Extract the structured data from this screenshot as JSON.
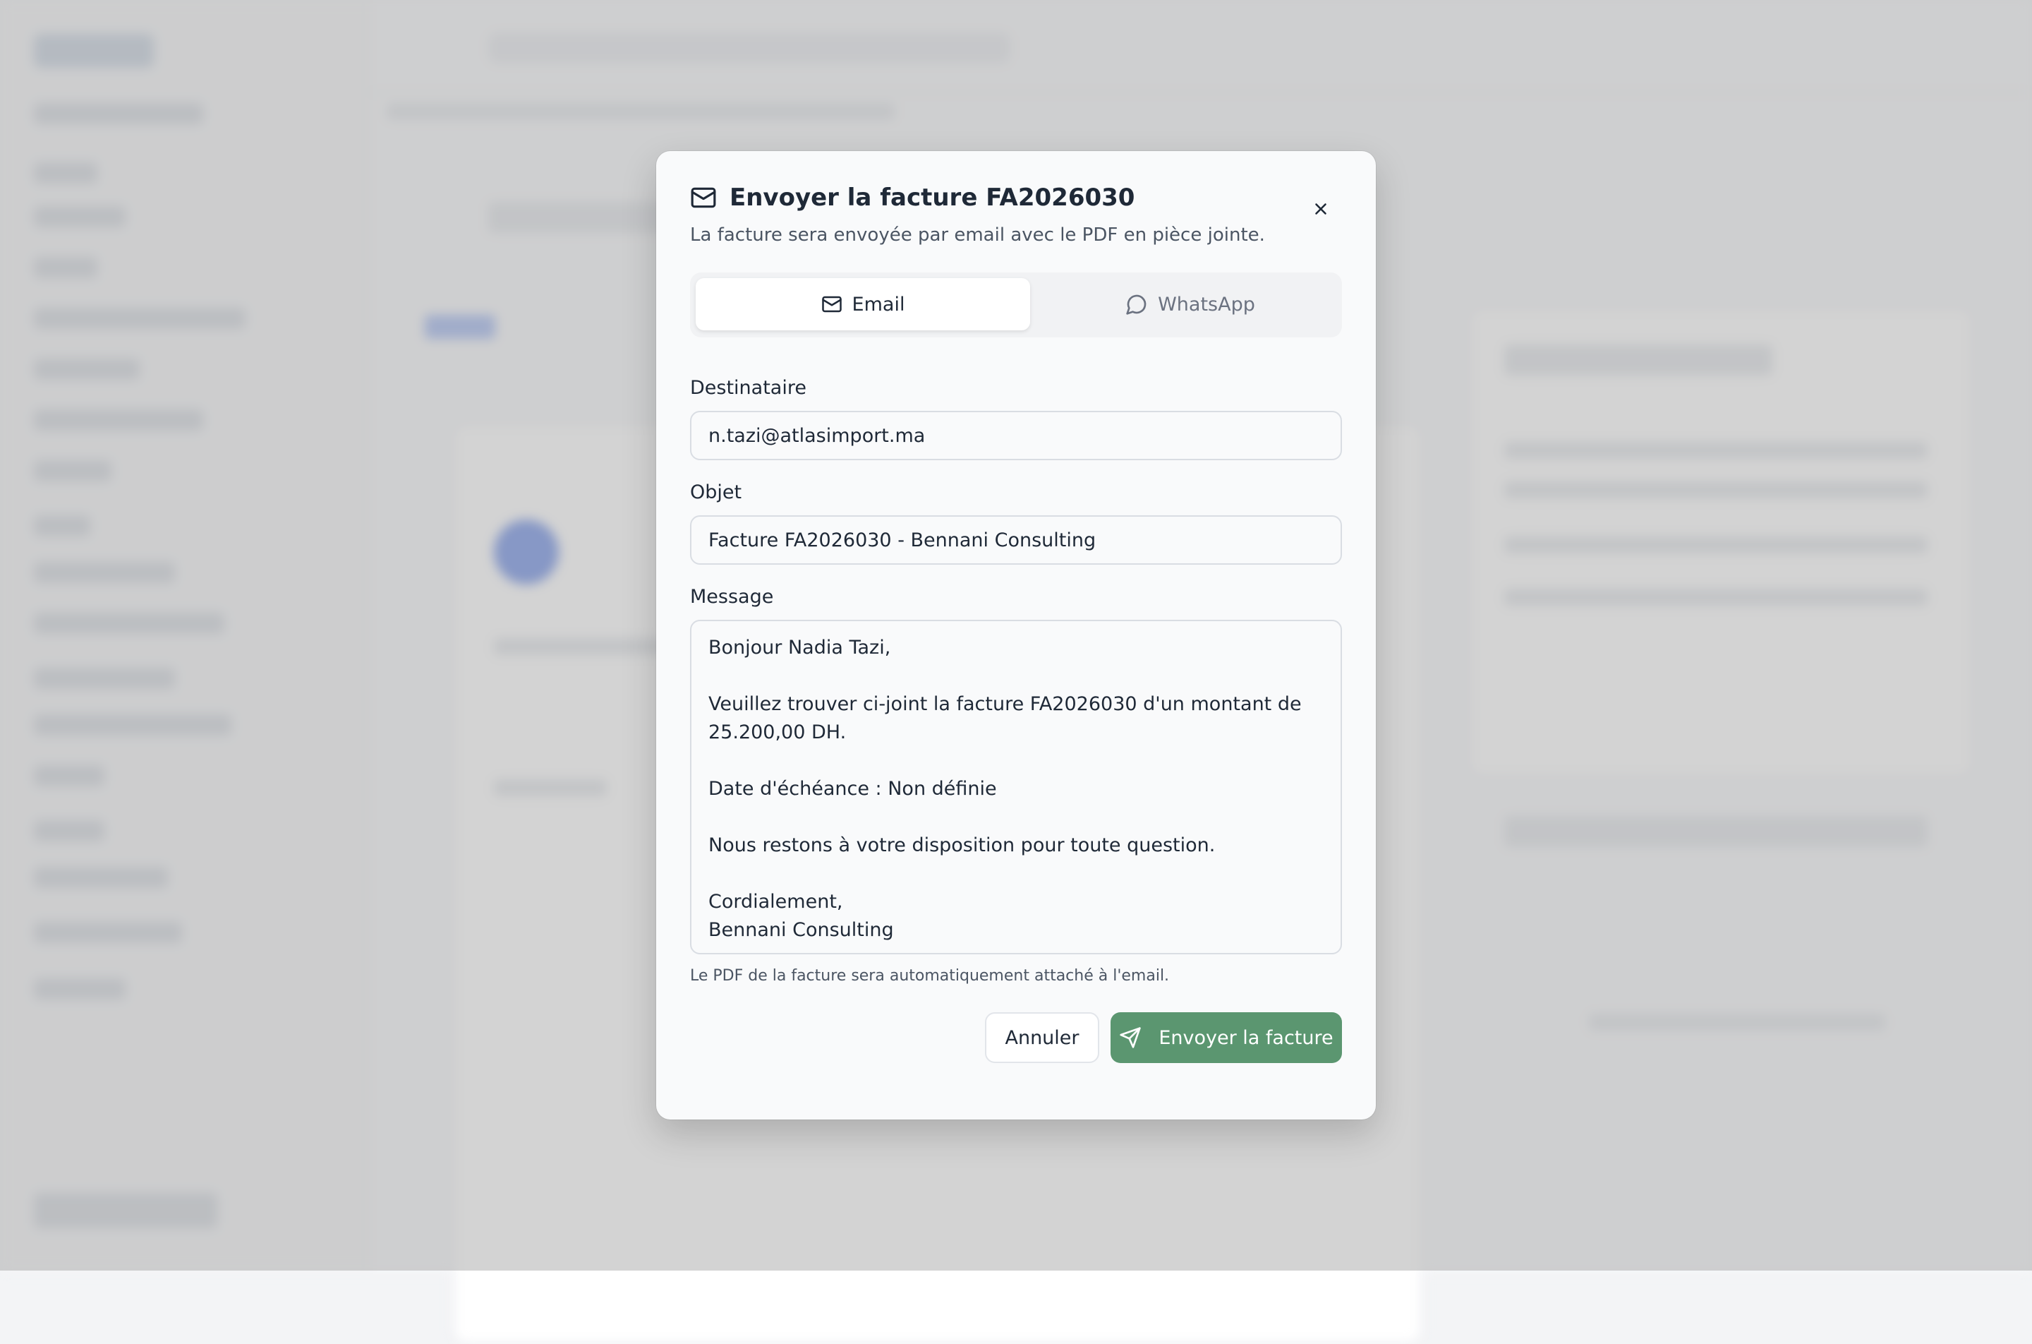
{
  "modal": {
    "title": "Envoyer la facture FA2026030",
    "subtitle": "La facture sera envoyée par email avec le PDF en pièce jointe.",
    "tabs": [
      {
        "label": "Email",
        "active": true,
        "icon": "mail-icon"
      },
      {
        "label": "WhatsApp",
        "active": false,
        "icon": "chat-bubble-icon"
      }
    ],
    "fields": {
      "recipient": {
        "label": "Destinataire",
        "value": "n.tazi@atlasimport.ma"
      },
      "subject": {
        "label": "Objet",
        "value": "Facture FA2026030 - Bennani Consulting"
      },
      "message": {
        "label": "Message",
        "lines": [
          "Bonjour Nadia Tazi,",
          "",
          "Veuillez trouver ci-joint la facture FA2026030 d'un montant de",
          "25.200,00 DH.",
          "",
          "Date d'échéance : Non définie",
          "",
          "Nous restons à votre disposition pour toute question.",
          "",
          "Cordialement,",
          "Bennani Consulting"
        ]
      }
    },
    "hint": "Le PDF de la facture sera automatiquement attaché à l'email.",
    "buttons": {
      "cancel": "Annuler",
      "send": "Envoyer la facture"
    },
    "colors": {
      "primary": "#5b9670",
      "overlay": "#9a9a9a"
    }
  }
}
